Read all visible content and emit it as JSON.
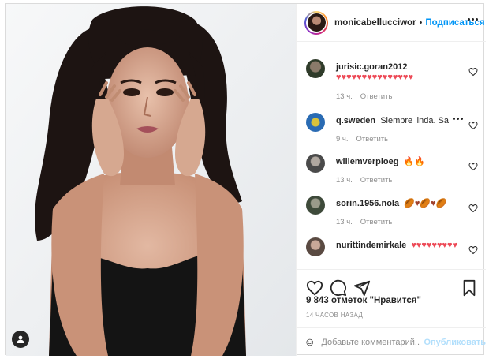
{
  "header": {
    "username": "monicabellucciwor",
    "separator": "•",
    "follow_label": "Подписаться"
  },
  "comments": [
    {
      "username": "jurisic.goran2012",
      "text": "♥♥♥♥♥♥♥♥♥♥♥♥♥♥♥",
      "time": "13 ч.",
      "reply": "Ответить",
      "emoji_kind": "heart"
    },
    {
      "username": "q.sweden",
      "text": "Siempre linda. Sa",
      "time": "9 ч.",
      "reply": "Ответить",
      "emoji_kind": "none"
    },
    {
      "username": "willemverploeg",
      "text": "🔥🔥",
      "time": "13 ч.",
      "reply": "Ответить",
      "emoji_kind": "fire"
    },
    {
      "username": "sorin.1956.nola",
      "text": "🏉♥🏉♥🏉",
      "time": "13 ч.",
      "reply": "Ответить",
      "emoji_kind": "mixed"
    },
    {
      "username": "nurittindemirkale",
      "text": "♥♥♥♥♥♥♥♥♥",
      "time": "",
      "reply": "",
      "emoji_kind": "heart"
    }
  ],
  "likes_text": "9 843 отметок \"Нравится\"",
  "time_ago": "14 ЧАСОВ НАЗАД",
  "add_comment": {
    "placeholder": "Добавьте комментарий...",
    "publish_label": "Опубликовать"
  },
  "icons": {
    "heart": "heart-icon",
    "comment": "comment-icon",
    "share": "share-icon",
    "save": "bookmark-icon",
    "emoji": "emoji-icon",
    "more": "more-icon",
    "user_tag": "user-tag-icon"
  },
  "colors": {
    "accent": "#0095f6",
    "accent_disabled": "#b2dffc",
    "text": "#262626",
    "muted": "#8e8e8e",
    "border": "#efefef",
    "emoji_heart": "#ed4956"
  }
}
